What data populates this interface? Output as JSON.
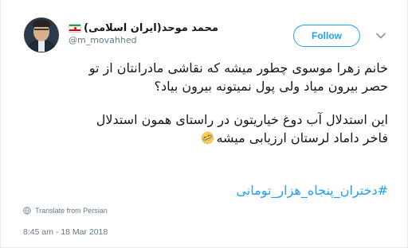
{
  "tweet": {
    "author": {
      "display_name": "محمد موحد(ایران اسلامی)",
      "handle": "@m_movahhed",
      "flag_icon": "iran-flag-icon"
    },
    "follow_label": "Follow",
    "text_lines": [
      "خانم زهرا موسوی چطور میشه که نقاشی مادرانتان از تو",
      "حصر بیرون میاد ولی پول نمیتونه بیرون بیاد؟",
      "این استدلال آب دوغ خیاریتون در راستای همون استدلال",
      "فاخر داماد لرستان ارزیابی میشه"
    ],
    "emoji_icon": "rolling-on-floor-laughing-icon",
    "hashtag": "#دختران_پنجاه_هزار_تومانی",
    "translate_label": "Translate from Persian",
    "timestamp": "8:45 am - 18 Mar 2018"
  },
  "colors": {
    "accent": "#1da1f2",
    "text": "#14171a",
    "muted": "#657786"
  }
}
